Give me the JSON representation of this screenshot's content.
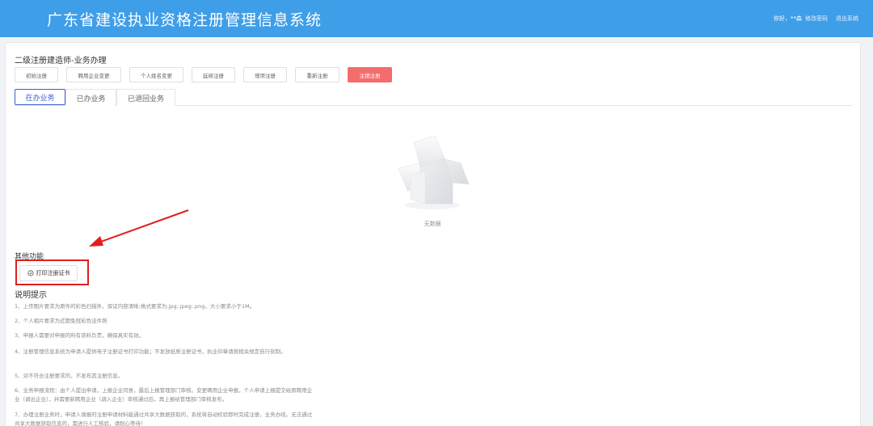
{
  "header": {
    "title": "广东省建设执业资格注册管理信息系统",
    "greeting": "你好，**森",
    "change_password": "修改密码",
    "logout": "退出系统"
  },
  "main": {
    "section_title": "二级注册建造师-业务办理",
    "operations": [
      "初始注册",
      "聘用企业变更",
      "个人姓名变更",
      "延续注册",
      "增项注册",
      "重新注册",
      "注销注册"
    ],
    "tabs": [
      "在办业务",
      "已办业务",
      "已退回业务"
    ],
    "empty_text": "无数据"
  },
  "other": {
    "title": "其他功能",
    "print_button": "打印注册证书"
  },
  "notes": {
    "title": "说明提示",
    "items": [
      "1、上传图片要求为原件的彩色扫描件，保证内容清晰;格式要求为.jpg;.jpeg;.png，大小要求小于1M。",
      "2、个人相片要求为近期免冠彩色证件照",
      "3、申报人需要对申报的所有资料负责，确保真实有效。",
      "4、注册管理信息系统为申请人提供电子注册证书打印功能；不发放纸质注册证书，执业印章请按相关规定自行刻制。",
      "5、对不符合注册要求的，不发布其注册信息。",
      "6、业务申报流程：由个人提出申请，上报企业同意，最后上报管理部门审核。变更聘用企业申报，个人申请上报提交给原聘用企业（调出企业），并需要新聘用企业（调入企业）审核通过后，再上报给管理部门审核发布。",
      "7、办理注册业务时，申请人填报的注册申请材料能通过共享大数据获取的，系统将自动校验即时完成注册，业务办结。无法通过共享大数据获取信息的，需进行人工核验，请耐心等待！"
    ]
  },
  "colors": {
    "header": "#3f9ee8",
    "danger": "#f56c6c",
    "active_tab": "#3a5fcd",
    "annotation": "#e02020"
  }
}
